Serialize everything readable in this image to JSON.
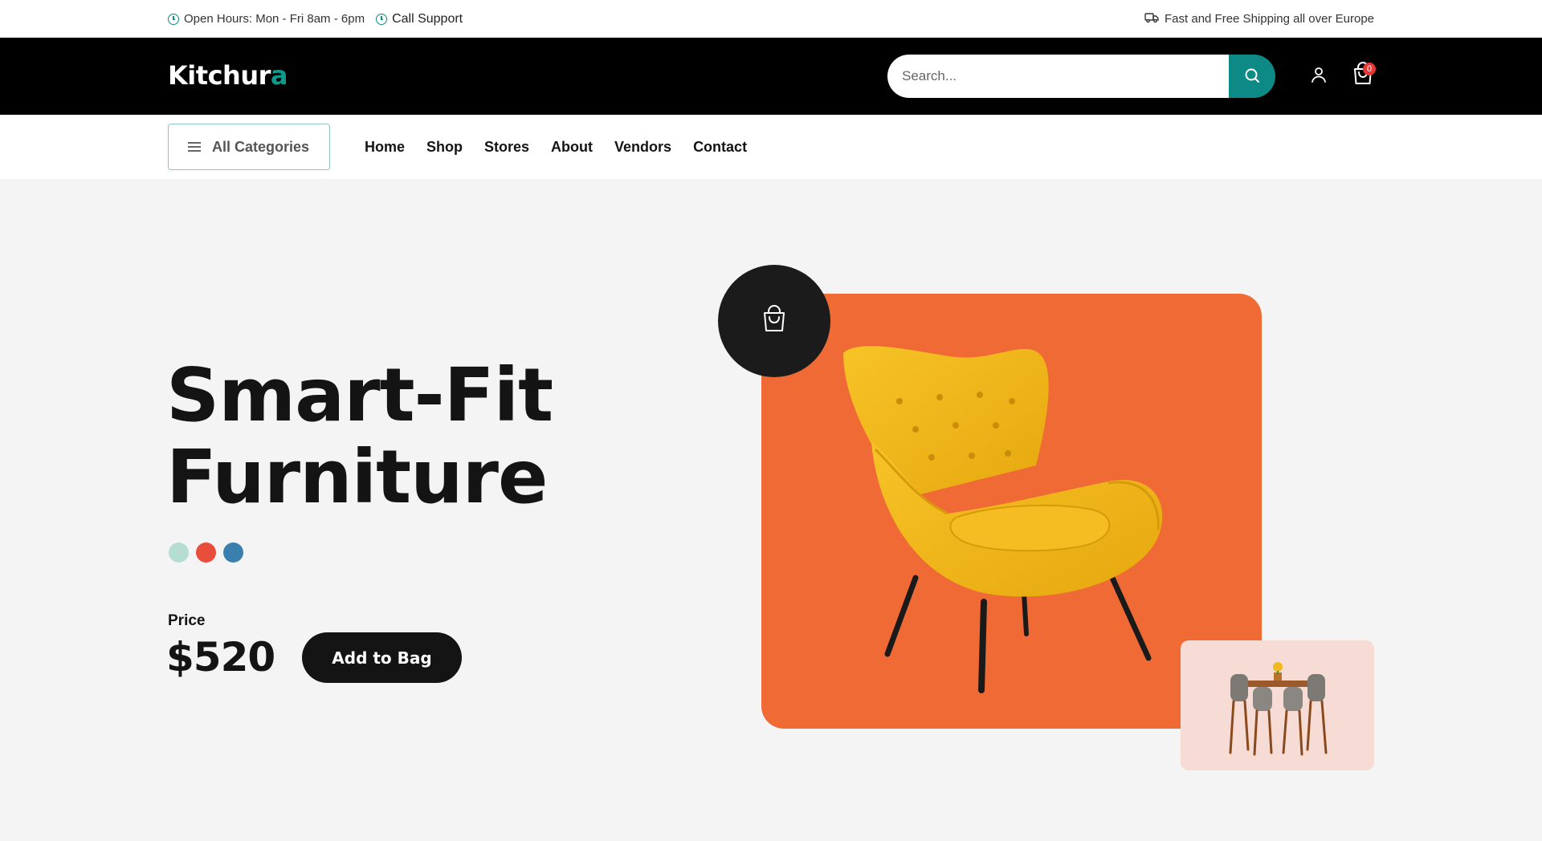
{
  "topbar": {
    "hours": "Open Hours: Mon - Fri 8am - 6pm",
    "support": "Call Support",
    "shipping": "Fast and Free Shipping all over Europe"
  },
  "header": {
    "logo_main": "Kitchur",
    "logo_accent": "a",
    "search_placeholder": "Search...",
    "cart_count": "0"
  },
  "nav": {
    "categories_label": "All Categories",
    "links": [
      "Home",
      "Shop",
      "Stores",
      "About",
      "Vendors",
      "Contact"
    ]
  },
  "hero": {
    "title_line1": "Smart-Fit",
    "title_line2": "Furniture",
    "swatches": [
      "#b6ddd2",
      "#e94e3c",
      "#3a7fad"
    ],
    "price_label": "Price",
    "price": "$520",
    "cta": "Add to Bag"
  },
  "colors": {
    "accent": "#0e8a86",
    "hero_card": "#f06a35",
    "dark": "#141414",
    "badge": "#e53935"
  },
  "icons": {
    "hours": "clock-icon",
    "support": "clock-icon",
    "shipping": "truck-icon",
    "search": "search-icon",
    "user": "user-icon",
    "cart": "shopping-bag-icon",
    "menu": "hamburger-icon",
    "bag": "shopping-bag-icon"
  }
}
